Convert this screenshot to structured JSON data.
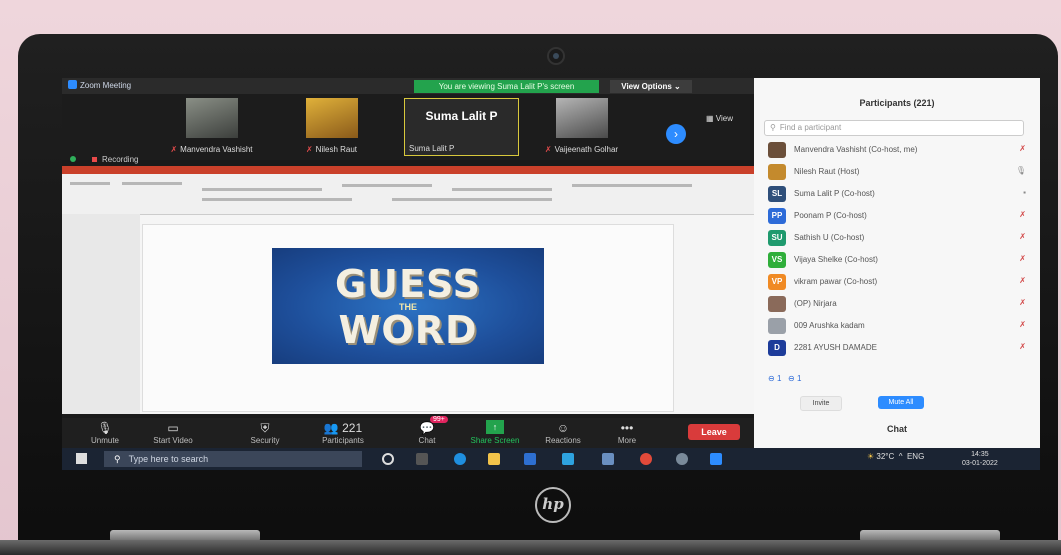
{
  "window": {
    "title": "Zoom Meeting"
  },
  "banner": {
    "viewing": "You are viewing Suma Lalit P's screen",
    "view_options": "View Options ⌄",
    "view": "View"
  },
  "video_tiles": [
    {
      "name": "Manvendra Vashisht",
      "muted": true
    },
    {
      "name": "Nilesh Raut",
      "muted": true
    },
    {
      "name": "Suma Lalit P",
      "active": true
    },
    {
      "name": "Vaijeenath Golhar",
      "muted": true
    }
  ],
  "recording": {
    "label": "Recording"
  },
  "slide": {
    "line1": "GUESS",
    "line2": "THE",
    "line3": "WORD"
  },
  "toolbar": {
    "unmute": "Unmute",
    "start_video": "Start Video",
    "security": "Security",
    "participants": "Participants",
    "participants_count": "221",
    "chat": "Chat",
    "chat_badge": "99+",
    "share_screen": "Share Screen",
    "reactions": "Reactions",
    "more": "More",
    "leave": "Leave"
  },
  "taskbar": {
    "search_placeholder": "Type here to search",
    "temp": "32°C",
    "lang": "ENG",
    "time": "14:35",
    "date": "03-01-2022"
  },
  "panel": {
    "title": "Participants (221)",
    "find_placeholder": "Find a participant",
    "participants": [
      {
        "name": "Manvendra Vashisht (Co-host, me)",
        "initials": "",
        "color": "#6b4f3a"
      },
      {
        "name": "Nilesh Raut (Host)",
        "initials": "",
        "color": "#c48a2d"
      },
      {
        "name": "Suma Lalit P (Co-host)",
        "initials": "SL",
        "color": "#2f4f7a"
      },
      {
        "name": "Poonam P (Co-host)",
        "initials": "PP",
        "color": "#2d6bd8"
      },
      {
        "name": "Sathish U (Co-host)",
        "initials": "SU",
        "color": "#1f9a6e"
      },
      {
        "name": "Vijaya Shelke (Co-host)",
        "initials": "VS",
        "color": "#2fae3a"
      },
      {
        "name": "vikram pawar (Co-host)",
        "initials": "VP",
        "color": "#f08a24"
      },
      {
        "name": "(OP) Nirjara",
        "initials": "",
        "color": "#8a6a5a"
      },
      {
        "name": "009 Arushka kadam",
        "initials": "",
        "color": "#9aa0a8"
      },
      {
        "name": "2281 AYUSH DAMADE",
        "initials": "D",
        "color": "#1d3c9a"
      }
    ],
    "invite": "Invite",
    "mute_all": "Mute All",
    "chat": "Chat",
    "counter_a": "1",
    "counter_b": "1"
  }
}
